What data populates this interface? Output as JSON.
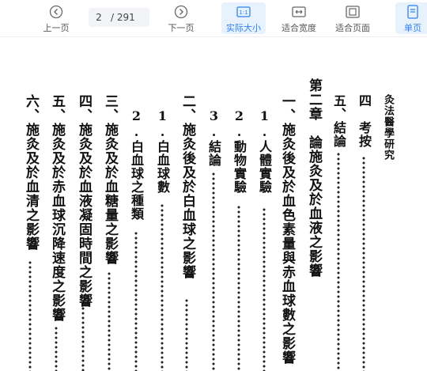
{
  "toolbar": {
    "prev_label": "上一页",
    "page_current": "2",
    "page_total": "/ 291",
    "next_label": "下一页",
    "actual_size_label": "实际大小",
    "fit_width_label": "适合宽度",
    "fit_page_label": "适合页面",
    "single_page_label": "单页"
  },
  "document": {
    "header": "灸法醫學研究",
    "lines": [
      "四　考按",
      "五、結論",
      "第二章　論施灸及於血液之影響",
      "一、施灸後及於血色素量與赤血球數之影響",
      "1.人體實驗",
      "2.動物實驗",
      "3.結論",
      "二、施灸後及於白血球之影響",
      "1.白血球數",
      "2.白血球之種類",
      "三、施灸及於血糖量之影響",
      "四、施灸及於血液凝固時間之影響",
      "五、施灸及於赤血球沉降速度之影響",
      "六、施灸及於血清之影響"
    ]
  }
}
